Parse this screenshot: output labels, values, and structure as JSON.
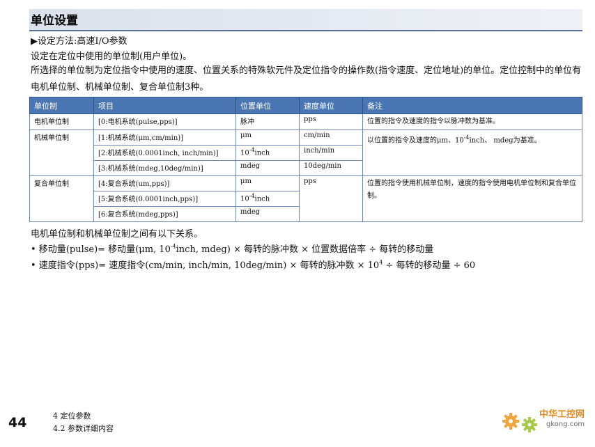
{
  "heading": "单位设置",
  "setting_method": "▶设定方法:高速I/O参数",
  "intro": "设定在定位中使用的单位制(用户单位)。",
  "paragraph": "所选择的单位制为定位指令中使用的速度、位置关系的特殊软元件及定位指令的操作数(指令速度、定位地址)的单位。定位控制中的单位有电机单位制、机械单位制、复合单位制3种。",
  "table": {
    "headers": [
      "单位制",
      "项目",
      "位置单位",
      "速度单位",
      "备注"
    ],
    "motor_group": "电机单位制",
    "machine_group": "机械单位制",
    "composite_group": "复合单位制",
    "row0": {
      "item": "[0:电机系统(pulse,pps)]",
      "pos": "脉冲",
      "speed": "pps",
      "note": "位置的指令及速度的指令以脉冲数为基准。"
    },
    "row1": {
      "item": "[1:机械系统(μm,cm/min)]",
      "pos": "μm",
      "speed": "cm/min"
    },
    "row2": {
      "item": "[2:机械系统(0.0001inch, inch/min)]",
      "pos_base": "10",
      "pos_exp": "-4",
      "pos_unit": "inch",
      "speed": "inch/min"
    },
    "row3": {
      "item": "[3:机械系统(mdeg,10deg/min)]",
      "pos": "mdeg",
      "speed": "10deg/min"
    },
    "machine_note_a": "以位置的指令及速度的μm、10",
    "machine_note_exp": "-4",
    "machine_note_b": "inch、 mdeg为基准。",
    "row4": {
      "item": "[4:复合系统(um,pps)]",
      "pos": "μm",
      "speed": "pps",
      "note": "位置的指令使用机械单位制，速度的指令使用电机单位制和复合单位制。"
    },
    "row5": {
      "item": "[5:复合系统(0.0001inch,pps)]",
      "pos_base": "10",
      "pos_exp": "-4",
      "pos_unit": "inch"
    },
    "row6": {
      "item": "[6:复合系统(mdeg,pps)]",
      "pos": "mdeg"
    }
  },
  "relation_intro": "电机单位制和机械单位制之间有以下关系。",
  "formula1_a": "• 移动量(pulse)= 移动量(μm, 10",
  "formula1_exp": "-4",
  "formula1_b": "inch, mdeg) × 每转的脉冲数 × 位置数据倍率 ÷ 每转的移动量",
  "formula2_a": "• 速度指令(pps)= 速度指令(cm/min, inch/min, 10deg/min) × 每转的脉冲数 × 10",
  "formula2_exp": "4",
  "formula2_b": " ÷ 每转的移动量 ÷ 60",
  "page_number": "44",
  "footer_chapter": "4   定位参数",
  "footer_section": "4.2   参数详细内容",
  "watermark_text": "中华工控网",
  "watermark_url": "gkong.com",
  "colors": {
    "header_bg": "#4a76b4",
    "title_bg": "#dbe1ec",
    "accent": "#e98a1e"
  }
}
